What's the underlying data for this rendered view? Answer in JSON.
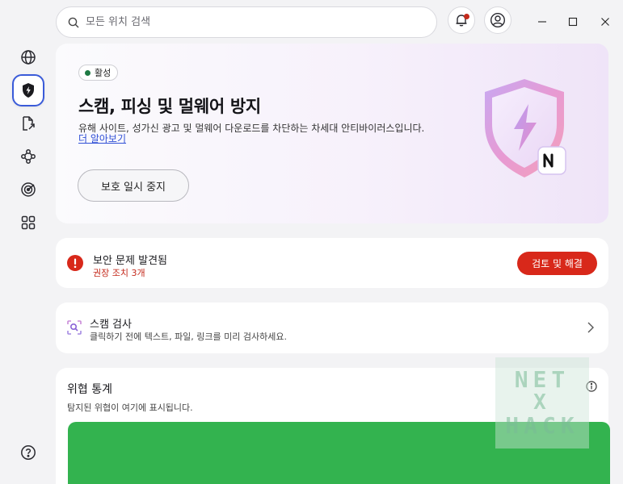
{
  "search": {
    "placeholder": "모든 위치 검색"
  },
  "titlebar": {
    "notification_icon": "bell-icon",
    "account_icon": "user-circle-icon",
    "notification_dot_color": "#c42a1c"
  },
  "sidebar": {
    "items": [
      {
        "icon": "globe-icon",
        "active": false
      },
      {
        "icon": "shield-bolt-icon",
        "active": true
      },
      {
        "icon": "document-arrow-icon",
        "active": false
      },
      {
        "icon": "network-nodes-icon",
        "active": false
      },
      {
        "icon": "radar-target-icon",
        "active": false
      },
      {
        "icon": "apps-grid-icon",
        "active": false
      }
    ],
    "help_icon": "question-circle-icon"
  },
  "hero": {
    "status": "활성",
    "title": "스캠, 피싱 및 멀웨어 방지",
    "description": "유해 사이트, 성가신 광고 및 멀웨어 다운로드를 차단하는 차세대 안티바이러스입니다.",
    "learn_more": "더 알아보기",
    "pause_button": "보호 일시 중지",
    "status_color": "#1e7a43"
  },
  "alert": {
    "title": "보안 문제 발견됨",
    "subtitle": "권장 조치 3개",
    "button": "검토 및 해결",
    "accent_color": "#d8281a"
  },
  "scan": {
    "title": "스캠 검사",
    "subtitle": "클릭하기 전에 텍스트, 파일, 링크를 미리 검사하세요."
  },
  "stats": {
    "title": "위협 통계",
    "subtitle": "탐지된 위협이 여기에 표시됩니다.",
    "chart_color": "#33b34f"
  },
  "watermark": {
    "lines": [
      "NET",
      "X",
      "HACK"
    ]
  }
}
